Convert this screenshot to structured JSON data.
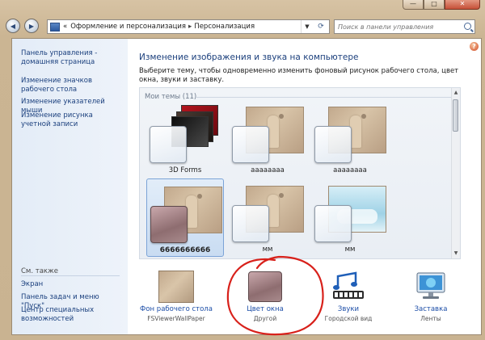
{
  "window": {
    "buttons": {
      "minimize": "—",
      "maximize": "□",
      "close": "✕"
    }
  },
  "nav": {
    "back_icon": "arrow-left-icon",
    "forward_icon": "arrow-right-icon",
    "address": {
      "prefix": "«",
      "segments": [
        "Оформление и персонализация",
        "Персонализация"
      ],
      "separator": "▸"
    },
    "search_placeholder": "Поиск в панели управления"
  },
  "sidebar": {
    "links": [
      "Панель управления - домашняя страница",
      "Изменение значков рабочего стола",
      "Изменение указателей мыши",
      "Изменение рисунка учетной записи"
    ],
    "see_also_title": "См. также",
    "see_also": [
      "Экран",
      "Панель задач и меню \"Пуск\"",
      "Центр специальных возможностей"
    ]
  },
  "main": {
    "heading": "Изменение изображения и звука на компьютере",
    "description": "Выберите тему, чтобы одновременно изменить фоновый рисунок рабочего стола, цвет окна, звуки и заставку.",
    "group_title": "Мои темы (11)",
    "themes": [
      {
        "name": "3D Forms",
        "selected": false
      },
      {
        "name": "аааааааа",
        "selected": false
      },
      {
        "name": "аааааааа",
        "selected": false
      },
      {
        "name": "6666666666",
        "selected": true
      },
      {
        "name": "мм",
        "selected": false
      },
      {
        "name": "мм",
        "selected": false
      }
    ]
  },
  "bottom": [
    {
      "label": "Фон рабочего стола",
      "sub": "FSViewerWallPaper"
    },
    {
      "label": "Цвет окна",
      "sub": "Другой"
    },
    {
      "label": "Звуки",
      "sub": "Городской вид"
    },
    {
      "label": "Заставка",
      "sub": "Ленты"
    }
  ],
  "colors": {
    "link": "#1a3f7d",
    "annotation": "#d8211b"
  }
}
